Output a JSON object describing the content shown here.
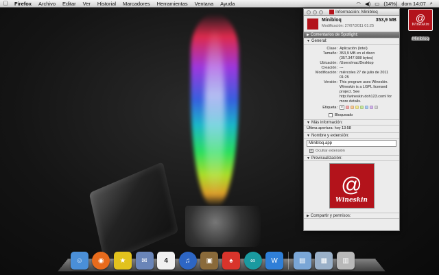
{
  "menubar": {
    "app_name": "Firefox",
    "items": [
      "Archivo",
      "Editar",
      "Ver",
      "Historial",
      "Marcadores",
      "Herramientas",
      "Ventana",
      "Ayuda"
    ],
    "battery": "(14%)",
    "clock": "dom 14:07"
  },
  "desktop_icon": {
    "label": "Minibloq",
    "logo_text": "Wineskin"
  },
  "info_window": {
    "title": "Información: Minibloq",
    "header": {
      "name": "Minibloq",
      "size": "353,9 MB",
      "modified": "Modificación:  27/07/2011 01:25"
    },
    "spotlight_section": "Comentarios de Spotlight:",
    "general_section": "General:",
    "general": [
      {
        "key": "Clase:",
        "value": "Aplicación (Intel)"
      },
      {
        "key": "Tamaño:",
        "value": "353,9 MB en el disco (357.347.988 bytes)"
      },
      {
        "key": "Ubicación:",
        "value": "/Users/mac/Desktop"
      },
      {
        "key": "Creación:",
        "value": "---"
      },
      {
        "key": "Modificación:",
        "value": "miércoles 27 de julio de 2011 01:25"
      },
      {
        "key": "Versión:",
        "value": "This program uses Wineskin. Wineskin is a LGPL licensed project.  See http://wineskin.doh123.com/ for more details."
      }
    ],
    "label_key": "Etiqueta:",
    "label_colors": [
      "#f3a6a6",
      "#f6c793",
      "#f2e68f",
      "#c5e59a",
      "#a9c9f0",
      "#d2b3ea",
      "#cfcfcf"
    ],
    "locked_label": "Bloqueado",
    "more_info_section": "Más información:",
    "last_opened": "Última apertura: hoy 13:58",
    "name_ext_section": "Nombre y extensión:",
    "name_value": "Minibloq.app",
    "hide_ext_label": "Ocultar extensión",
    "preview_section": "Previsualización:",
    "preview_logo_text": "Wineskin",
    "share_section": "Compartir y permisos:"
  },
  "dock": [
    {
      "name": "finder",
      "glyph": "☺",
      "color": "#4a8fd8"
    },
    {
      "name": "firefox",
      "glyph": "◉",
      "color": "#e86b1c"
    },
    {
      "name": "bridge",
      "glyph": "★",
      "color": "#e2c21d"
    },
    {
      "name": "mail",
      "glyph": "✉",
      "color": "#6a85b8"
    },
    {
      "name": "calendar",
      "glyph": "4",
      "color": "#f0f0f0"
    },
    {
      "name": "itunes",
      "glyph": "♫",
      "color": "#2d66c4"
    },
    {
      "name": "iphoto",
      "glyph": "▣",
      "color": "#8a6a3a"
    },
    {
      "name": "flame-app",
      "glyph": "♠",
      "color": "#d9342b"
    },
    {
      "name": "arduino",
      "glyph": "∞",
      "color": "#1a9aa0"
    },
    {
      "name": "wineskin-w",
      "glyph": "W",
      "color": "#2f7fd8"
    },
    {
      "name": "folder",
      "glyph": "▤",
      "color": "#7aa6d6"
    },
    {
      "name": "preview",
      "glyph": "▦",
      "color": "#9ab0c8"
    },
    {
      "name": "trash",
      "glyph": "▥",
      "color": "#b8b8b8"
    }
  ]
}
